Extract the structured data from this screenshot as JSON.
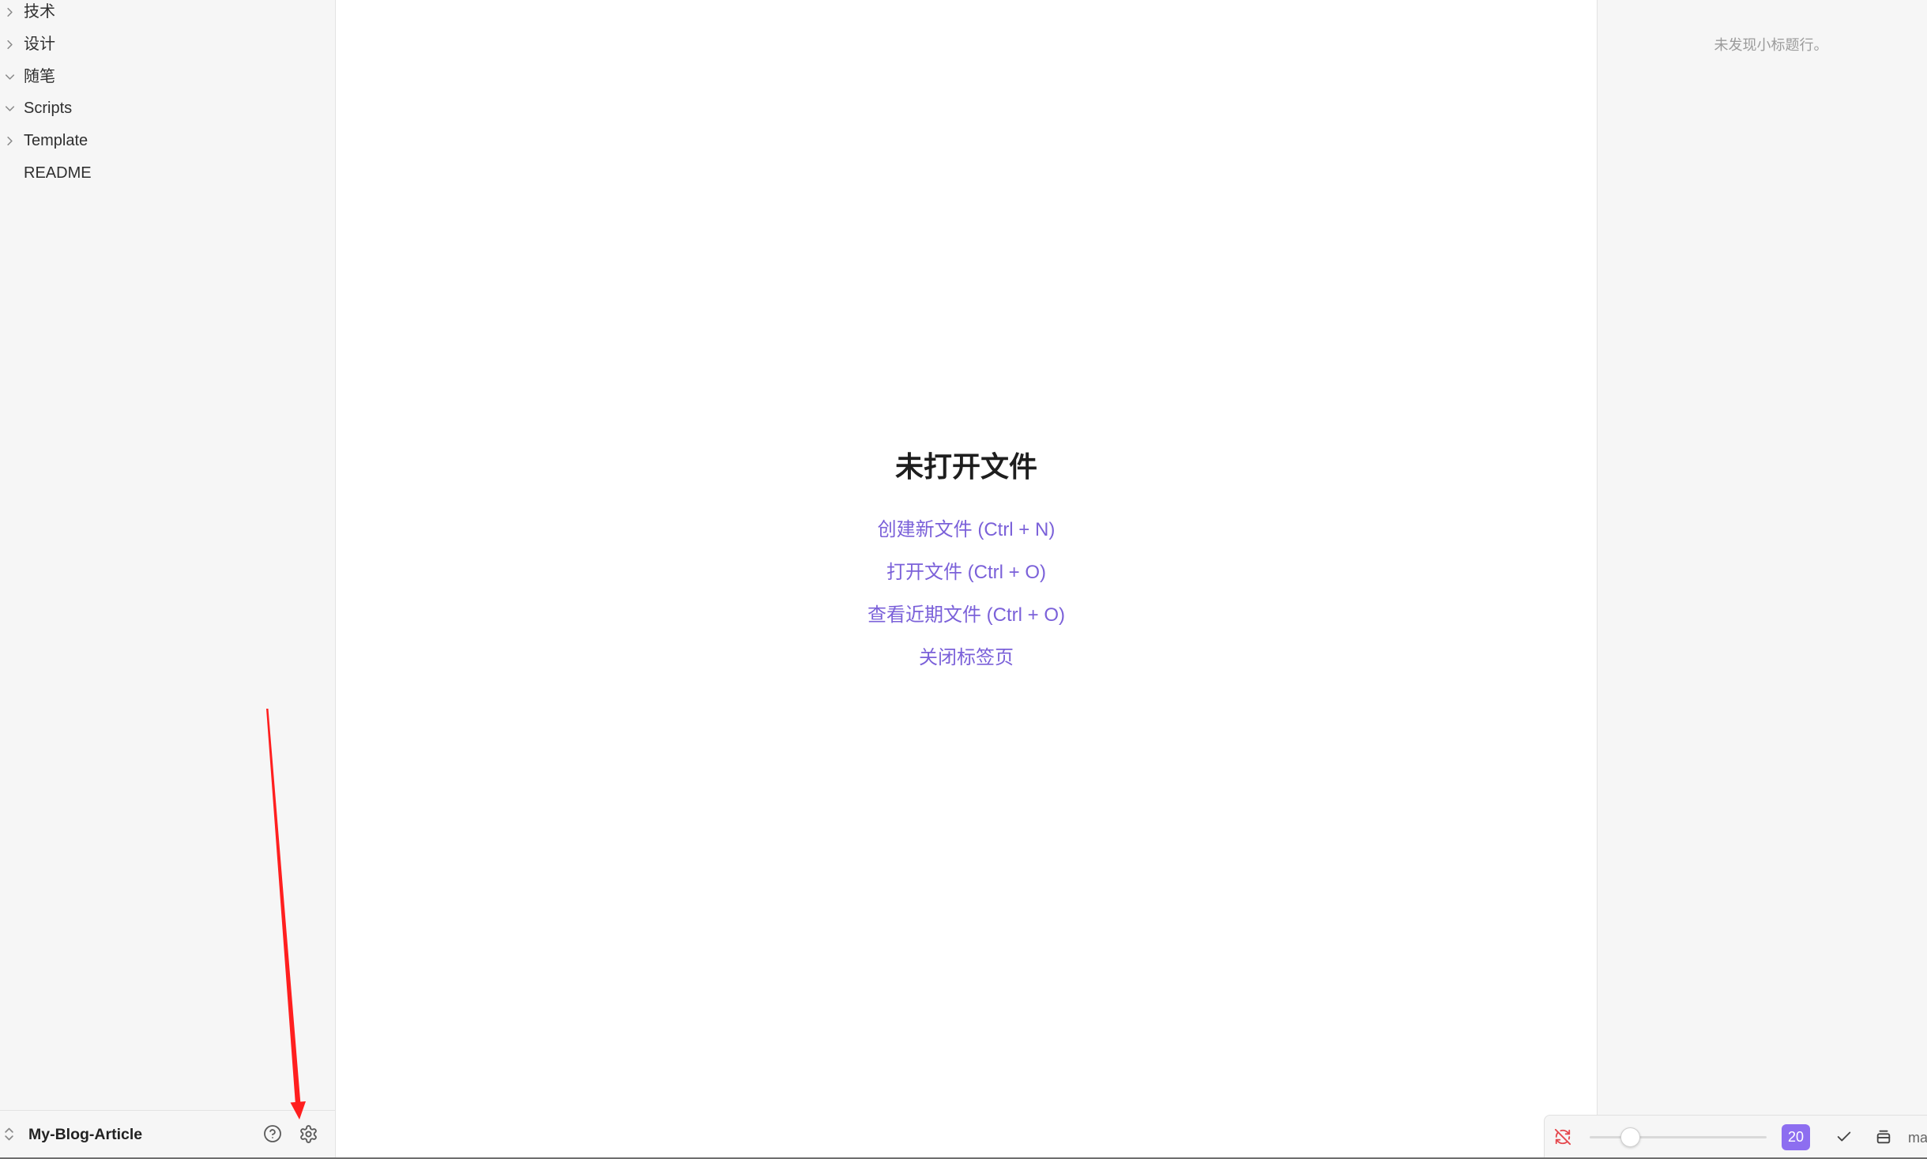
{
  "sidebar": {
    "tree": [
      {
        "label": "技术",
        "chevron_icon": "chevron-right-icon"
      },
      {
        "label": "设计",
        "chevron_icon": "chevron-right-icon"
      },
      {
        "label": "随笔",
        "chevron_icon": "chevron-down-icon"
      },
      {
        "label": "Scripts",
        "chevron_icon": "chevron-down-icon"
      },
      {
        "label": "Template",
        "chevron_icon": "chevron-right-icon"
      },
      {
        "label": "README"
      }
    ],
    "vault": {
      "name": "My-Blog-Article",
      "switch_icon": "chevron-up-down-icon",
      "help_icon": "help-circle-icon",
      "settings_icon": "gear-icon"
    }
  },
  "empty_state": {
    "title": "未打开文件",
    "actions": [
      "创建新文件 (Ctrl + N)",
      "打开文件 (Ctrl + O)",
      "查看近期文件 (Ctrl + O)",
      "关闭标签页"
    ]
  },
  "outline": {
    "empty_message": "未发现小标题行。"
  },
  "status_bar": {
    "sync_icon": "sync-off-icon",
    "slider_level": 0.23,
    "badge": "20",
    "check_icon": "check-icon",
    "stack_icon": "stack-icon",
    "label": "ma"
  },
  "colors": {
    "accent": "#7b61d9",
    "badge": "#8d6ef0",
    "sync_off": "#e5484d",
    "annotation_arrow": "#ff1f1f",
    "panel": "#f6f6f6"
  }
}
